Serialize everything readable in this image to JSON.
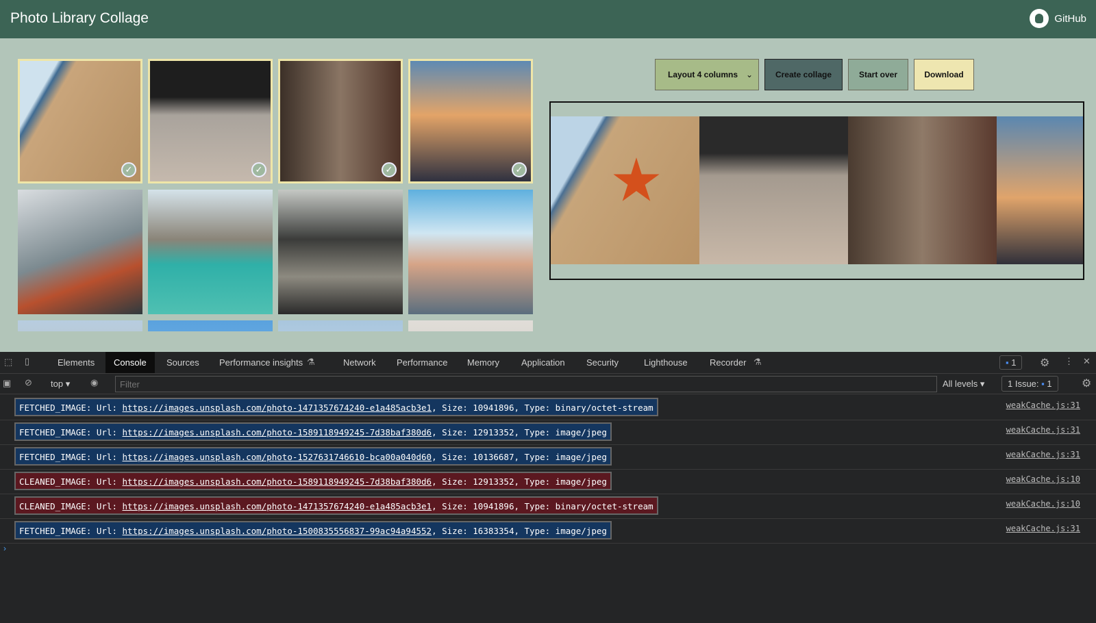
{
  "header": {
    "title": "Photo Library Collage",
    "github_label": "GitHub"
  },
  "gallery": {
    "photos": [
      {
        "subject": "starfish",
        "selected": true
      },
      {
        "subject": "bicycle",
        "selected": true
      },
      {
        "subject": "alley",
        "selected": true
      },
      {
        "subject": "clouds-wing",
        "selected": true
      },
      {
        "subject": "hiker-lake",
        "selected": false
      },
      {
        "subject": "lake-boat",
        "selected": false
      },
      {
        "subject": "bridge",
        "selected": false
      },
      {
        "subject": "venice",
        "selected": false
      },
      {
        "subject": "beach",
        "selected": false
      },
      {
        "subject": "sky",
        "selected": false
      },
      {
        "subject": "sky2",
        "selected": false
      },
      {
        "subject": "sand",
        "selected": false
      }
    ]
  },
  "controls": {
    "layout_select": "Layout 4 columns",
    "create": "Create collage",
    "start_over": "Start over",
    "download": "Download"
  },
  "devtools": {
    "tabs": [
      "Elements",
      "Console",
      "Sources",
      "Performance insights",
      "Network",
      "Performance",
      "Memory",
      "Application",
      "Security",
      "Lighthouse",
      "Recorder"
    ],
    "active_tab": "Console",
    "context": "top",
    "filter_placeholder": "Filter",
    "levels": "All levels",
    "issues_label": "1 Issue:",
    "issues_count": "1",
    "messages_badge": "1",
    "logs": [
      {
        "kind": "FETCHED_IMAGE",
        "prefix": "FETCHED_IMAGE: Url: ",
        "url": "https://images.unsplash.com/photo-1471357674240-e1a485acb3e1",
        "rest": ", Size: 10941896, Type: binary/octet-stream",
        "source": "weakCache.js:31"
      },
      {
        "kind": "FETCHED_IMAGE",
        "prefix": "FETCHED_IMAGE: Url: ",
        "url": "https://images.unsplash.com/photo-1589118949245-7d38baf380d6",
        "rest": ", Size: 12913352, Type: image/jpeg",
        "source": "weakCache.js:31"
      },
      {
        "kind": "FETCHED_IMAGE",
        "prefix": "FETCHED_IMAGE: Url: ",
        "url": "https://images.unsplash.com/photo-1527631746610-bca00a040d60",
        "rest": ", Size: 10136687, Type: image/jpeg",
        "source": "weakCache.js:31"
      },
      {
        "kind": "CLEANED_IMAGE",
        "prefix": "CLEANED_IMAGE: Url: ",
        "url": "https://images.unsplash.com/photo-1589118949245-7d38baf380d6",
        "rest": ", Size: 12913352, Type: image/jpeg",
        "source": "weakCache.js:10"
      },
      {
        "kind": "CLEANED_IMAGE",
        "prefix": "CLEANED_IMAGE: Url: ",
        "url": "https://images.unsplash.com/photo-1471357674240-e1a485acb3e1",
        "rest": ", Size: 10941896, Type: binary/octet-stream",
        "source": "weakCache.js:10"
      },
      {
        "kind": "FETCHED_IMAGE",
        "prefix": "FETCHED_IMAGE: Url: ",
        "url": "https://images.unsplash.com/photo-1500835556837-99ac94a94552",
        "rest": ", Size: 16383354, Type: image/jpeg",
        "source": "weakCache.js:31"
      }
    ]
  },
  "colors": {
    "header": "#3c6455",
    "page": "#b2c5b9",
    "fetched": "#14365f",
    "cleaned": "#5b1820",
    "select": "#a7bb88",
    "create": "#4f6866",
    "start_over": "#8fab98",
    "download": "#eee6b0"
  }
}
